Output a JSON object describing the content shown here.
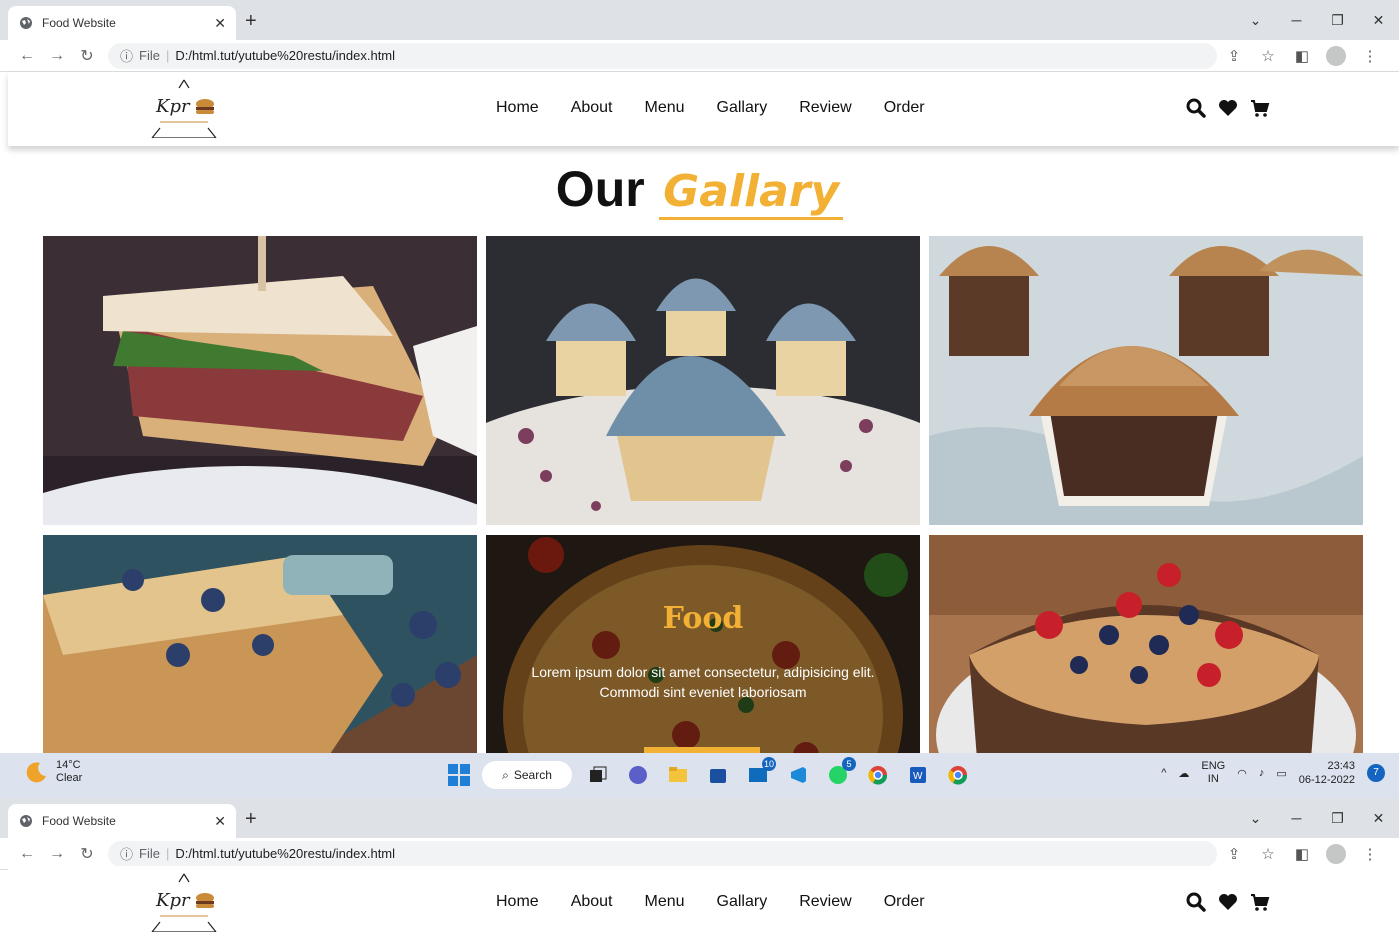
{
  "browser": {
    "tab_title": "Food Website",
    "address": {
      "file_label": "File",
      "url": "D:/html.tut/yutube%20restu/index.html"
    }
  },
  "site": {
    "logo_text": "Kpr",
    "nav": [
      "Home",
      "About",
      "Menu",
      "Gallary",
      "Review",
      "Order"
    ],
    "icons": [
      "search-icon",
      "heart-icon",
      "cart-icon"
    ]
  },
  "gallery": {
    "heading_primary": "Our",
    "heading_accent": "Gallary",
    "items": [
      {
        "name": "sandwich"
      },
      {
        "name": "blue-cupcakes"
      },
      {
        "name": "chocolate-cupcakes"
      },
      {
        "name": "blueberry-loaf"
      },
      {
        "name": "pizza",
        "overlay_title": "Food",
        "overlay_text": "Lorem ipsum dolor sit amet consectetur, adipisicing elit. Commodi sint eveniet laboriosam"
      },
      {
        "name": "berry-cake"
      }
    ],
    "accent_color": "#f2b134"
  },
  "taskbar": {
    "weather_temp": "14°C",
    "weather_cond": "Clear",
    "search_label": "Search",
    "badge_outlook": "10",
    "badge_whatsapp": "5",
    "lang_top": "ENG",
    "lang_bottom": "IN",
    "time": "23:43",
    "date": "06-12-2022",
    "notifications": "7"
  }
}
